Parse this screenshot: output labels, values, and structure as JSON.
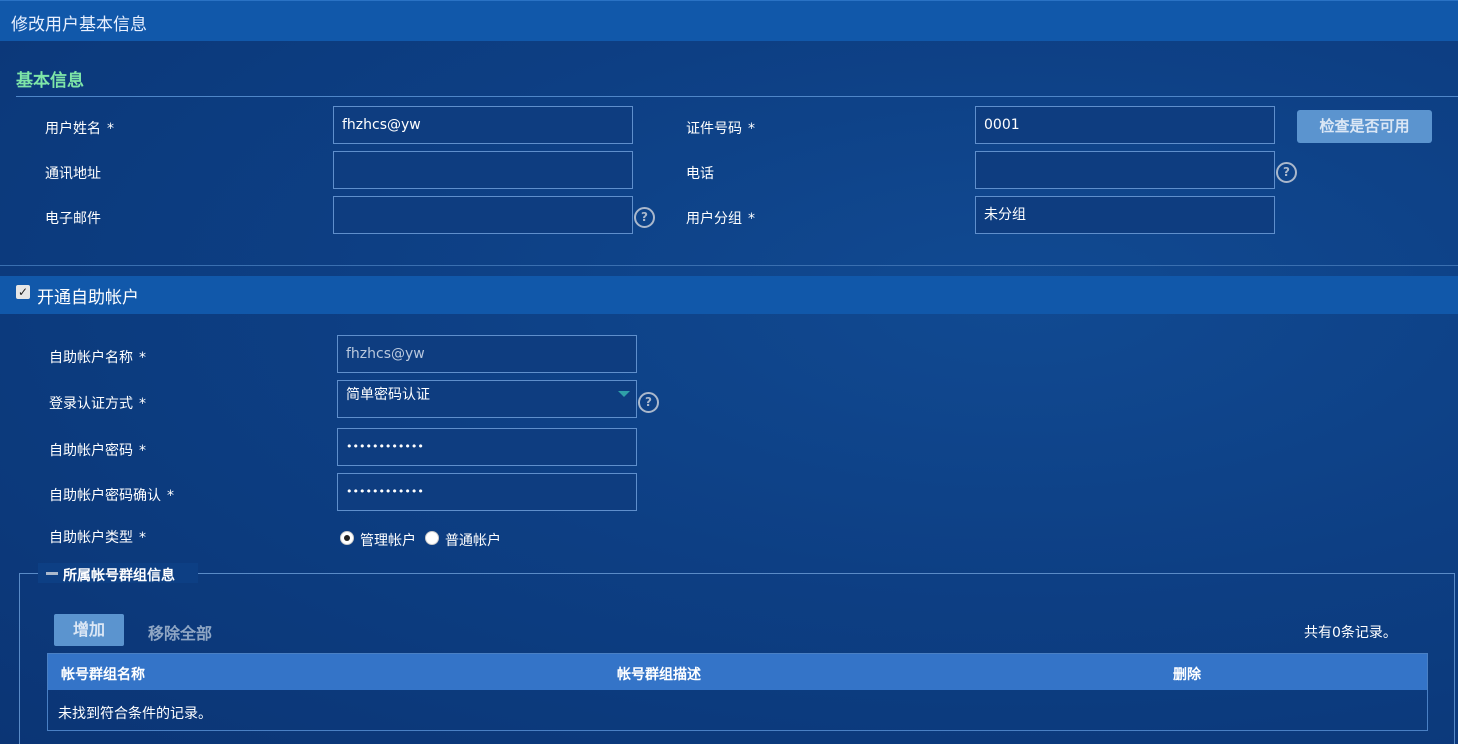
{
  "window": {
    "title": "修改用户基本信息"
  },
  "basic": {
    "section_title": "基本信息",
    "username_label": "用户姓名",
    "username_value": "fhzhcs@yw",
    "id_label": "证件号码",
    "id_value": "0001",
    "check_button": "检查是否可用",
    "address_label": "通讯地址",
    "address_value": "",
    "phone_label": "电话",
    "phone_value": "",
    "email_label": "电子邮件",
    "email_value": "",
    "group_label": "用户分组",
    "group_value": "未分组",
    "required_mark": "*"
  },
  "selfservice": {
    "enable_label": "开通自助帐户",
    "enabled": true,
    "account_name_label": "自助帐户名称",
    "account_name_value": "fhzhcs@yw",
    "auth_label": "登录认证方式",
    "auth_value": "简单密码认证",
    "password_label": "自助帐户密码",
    "password_value": "••••••••••••",
    "password_confirm_label": "自助帐户密码确认",
    "password_confirm_value": "••••••••••••",
    "type_label": "自助帐户类型",
    "type_options": [
      "管理帐户",
      "普通帐户"
    ],
    "type_selected": "管理帐户"
  },
  "groups": {
    "legend": "所属帐号群组信息",
    "add_button": "增加",
    "remove_all_button": "移除全部",
    "record_count": "共有0条记录。",
    "columns": [
      "帐号群组名称",
      "帐号群组描述",
      "删除"
    ],
    "empty_message": "未找到符合条件的记录。"
  },
  "icons": {
    "help": "help-icon",
    "collapse": "minus-icon",
    "dropdown": "chevron-down-icon"
  },
  "colors": {
    "background": "#0d3a7a",
    "bar": "#1158aa",
    "section_title": "#7ee6a8",
    "button": "#5b94cf",
    "table_header": "#3474c8"
  }
}
